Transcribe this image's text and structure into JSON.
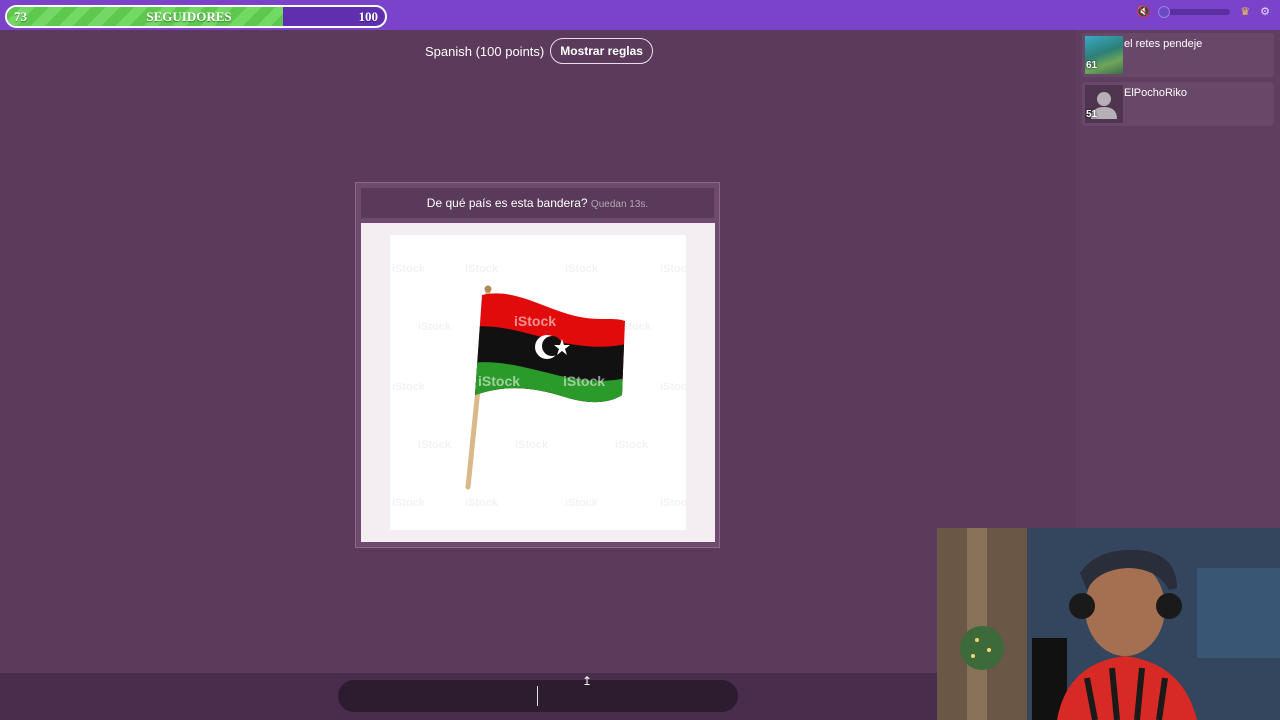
{
  "goal": {
    "current": "73",
    "label": "SEGUIDORES",
    "target": "100",
    "progress": 0.73
  },
  "top_icons": [
    "mute-icon",
    "volume-slider",
    "crown-icon",
    "settings-icon"
  ],
  "game": {
    "language_text": "Spanish (100 points)",
    "rules_button": "Mostrar reglas"
  },
  "question": {
    "text": "De qué país es esta bandera?",
    "timer": "Quedan 13s.",
    "image_watermark": "iStock"
  },
  "players": [
    {
      "name": "el retes pendeje",
      "score": "61",
      "avatar": "photo"
    },
    {
      "name": "ElPochoRiko",
      "score": "51",
      "avatar": "default-user-icon"
    }
  ],
  "answer": {
    "value": "",
    "placeholder": ""
  },
  "colors": {
    "background": "#5b3a5c",
    "topbar": "#7b43c9",
    "progress": "#5ec84e",
    "flag_red": "#e10b0b",
    "flag_black": "#111111",
    "flag_green": "#2a9a2a"
  }
}
